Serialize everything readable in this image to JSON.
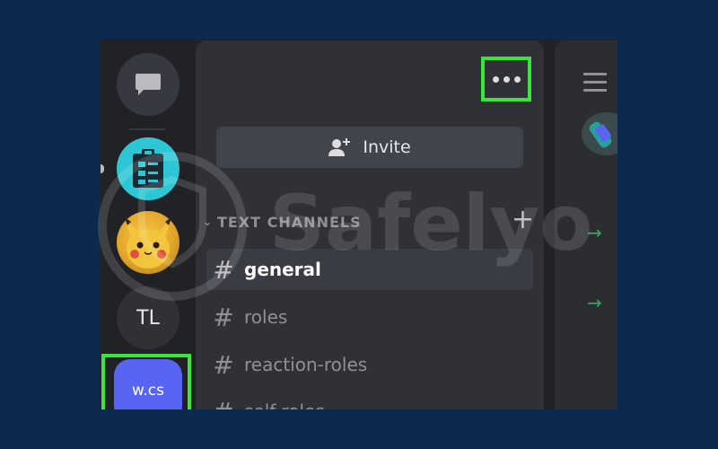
{
  "colors": {
    "background": "#0b2a4e",
    "highlight": "#39e639",
    "blurple": "#5865f2",
    "panel": "#2f3136"
  },
  "rail": {
    "direct_messages_icon": "chat-bubble-icon",
    "servers": [
      {
        "icon": "clipboard-icon",
        "label": ""
      },
      {
        "icon": "pikachu-avatar",
        "label": ""
      },
      {
        "icon": "",
        "label": "TL"
      },
      {
        "icon": "",
        "label": "w.cs"
      }
    ]
  },
  "header": {
    "more_options_icon": "ellipsis-icon"
  },
  "invite": {
    "icon": "add-person-icon",
    "label": "Invite"
  },
  "category": {
    "label": "TEXT CHANNELS",
    "add_icon": "plus-icon"
  },
  "channels": [
    {
      "name": "general",
      "active": true
    },
    {
      "name": "roles",
      "active": false
    },
    {
      "name": "reaction-roles",
      "active": false
    },
    {
      "name": "self-roles",
      "active": false
    }
  ],
  "watermark": {
    "text": "Safelyo"
  }
}
